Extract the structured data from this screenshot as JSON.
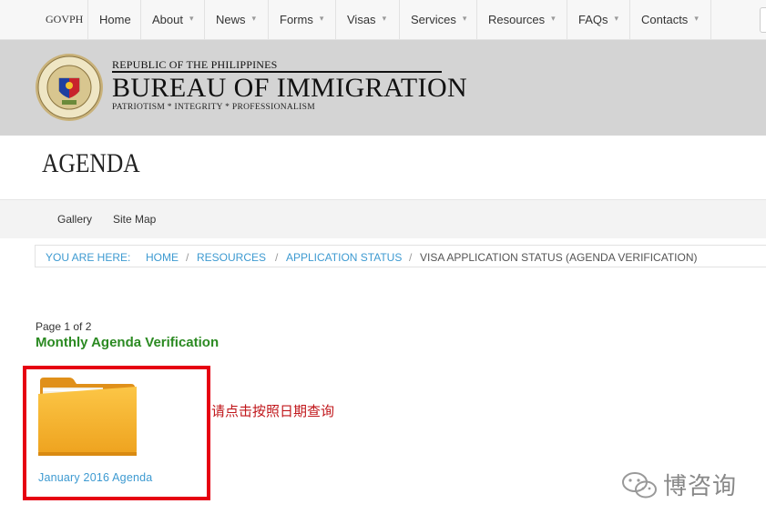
{
  "nav": {
    "items": [
      {
        "label": "GOVPH",
        "dropdown": false
      },
      {
        "label": "Home",
        "dropdown": false
      },
      {
        "label": "About",
        "dropdown": true
      },
      {
        "label": "News",
        "dropdown": true
      },
      {
        "label": "Forms",
        "dropdown": true
      },
      {
        "label": "Visas",
        "dropdown": true
      },
      {
        "label": "Services",
        "dropdown": true
      },
      {
        "label": "Resources",
        "dropdown": true
      },
      {
        "label": "FAQs",
        "dropdown": true
      },
      {
        "label": "Contacts",
        "dropdown": true
      }
    ],
    "caret": "▾"
  },
  "header": {
    "republic": "REPUBLIC OF THE PHILIPPINES",
    "bureau": "BUREAU OF IMMIGRATION",
    "motto": "PATRIOTISM * INTEGRITY * PROFESSIONALISM",
    "seal_text_top": "BUREAU OF IMMIGRATION",
    "seal_text_bottom": "DEPARTMENT OF JUSTICE"
  },
  "page": {
    "title": "AGENDA"
  },
  "subnav": {
    "gallery": "Gallery",
    "sitemap": "Site Map"
  },
  "breadcrumb": {
    "label": "YOU ARE HERE:",
    "home": "HOME",
    "resources": "RESOURCES",
    "application_status": "APPLICATION STATUS",
    "current": "VISA APPLICATION STATUS (AGENDA VERIFICATION)",
    "separator": "/"
  },
  "content": {
    "page_count": "Page 1 of 2",
    "section_title": "Monthly Agenda Verification",
    "folder_link": "January 2016 Agenda",
    "annotation": "请点击按照日期查询"
  },
  "watermark": {
    "text": "博咨询"
  },
  "colors": {
    "link": "#3d9ad1",
    "section_green": "#2b8a22",
    "highlight_red": "#e60012",
    "annotation_red": "#c0161a",
    "folder": "#f2a526"
  }
}
